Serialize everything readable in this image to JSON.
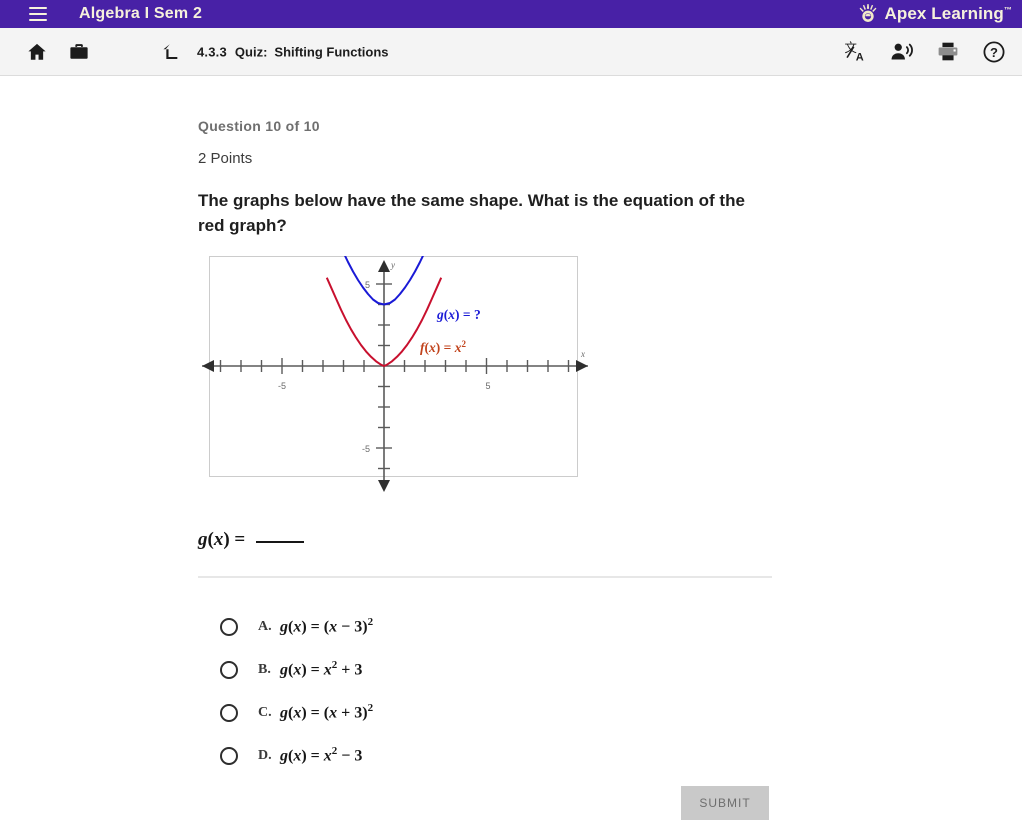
{
  "appbar": {
    "menu_icon": "hamburger-menu-icon",
    "course_title": "Algebra I Sem 2",
    "brand_name": "Apex Learning",
    "brand_tm": "™",
    "brand_logo": "apex-sunburst-logo",
    "background_color": "#4821a6",
    "text_color": "#f6f1dc"
  },
  "toolbar": {
    "home_icon": "home-icon",
    "briefcase_icon": "briefcase-icon",
    "up_level_icon": "up-level-arrow-icon",
    "breadcrumb": {
      "number": "4.3.3",
      "kind": "Quiz:",
      "name": "Shifting Functions"
    },
    "translate_icon": "translate-icon",
    "read_aloud_icon": "read-aloud-icon",
    "print_icon": "print-icon",
    "help_icon": "help-circle-icon",
    "background_color": "#f4f4f4"
  },
  "question": {
    "counter": "Question 10 of 10",
    "points": "2 Points",
    "prompt": "The graphs below have the same shape. What is the equation of the red graph?",
    "answer_prompt_g": "g",
    "answer_prompt_paren_open": "(",
    "answer_prompt_x": "x",
    "answer_prompt_paren_close": ")",
    "answer_prompt_equals": " = "
  },
  "chart_data": {
    "type": "line",
    "title": "",
    "xlabel": "x",
    "ylabel": "y",
    "xlim": [
      -9,
      9
    ],
    "ylim": [
      -7.5,
      7.5
    ],
    "grid": false,
    "tick_step": 1,
    "xticks_labeled": [
      -5,
      5
    ],
    "yticks_labeled": [
      -5,
      5
    ],
    "xtick_labels": [
      "-5",
      "5"
    ],
    "ytick_labels": [
      "-5",
      "5"
    ],
    "series": [
      {
        "name": "f(x) = x2",
        "label": "f(x) = x",
        "label_exponent": "2",
        "color": "#c8102e",
        "vertex": [
          0,
          0
        ],
        "equation": "y = x^2",
        "points": [
          [
            -2.7,
            7.3
          ],
          [
            -2.2,
            4.84
          ],
          [
            -1.7,
            2.89
          ],
          [
            -1.2,
            1.44
          ],
          [
            -0.7,
            0.49
          ],
          [
            0,
            0
          ],
          [
            0.7,
            0.49
          ],
          [
            1.2,
            1.44
          ],
          [
            1.7,
            2.89
          ],
          [
            2.2,
            4.84
          ],
          [
            2.7,
            7.3
          ]
        ]
      },
      {
        "name": "g(x) = ?",
        "label": "g(x) = ?",
        "color": "#1a1ad6",
        "vertex": [
          0,
          3
        ],
        "equation": "y = x^2 + 3",
        "points": [
          [
            -2.1,
            7.41
          ],
          [
            -1.7,
            5.89
          ],
          [
            -1.2,
            4.44
          ],
          [
            -0.7,
            3.49
          ],
          [
            0,
            3
          ],
          [
            0.7,
            3.49
          ],
          [
            1.2,
            4.44
          ],
          [
            1.7,
            5.89
          ],
          [
            2.1,
            7.41
          ]
        ]
      }
    ],
    "annotations": [
      {
        "text": "g(x) = ?",
        "x": 2.6,
        "y": 5.0,
        "color": "#1a1ad6"
      },
      {
        "text": "f(x) = x",
        "sup": "2",
        "x": 1.9,
        "y": 1.6,
        "color": "#c1431c"
      }
    ]
  },
  "choices": [
    {
      "letter": "A.",
      "g": "g",
      "x1": "x",
      "eq": " = (",
      "x2": "x",
      "op": " − 3)",
      "sup": "2",
      "tail": ""
    },
    {
      "letter": "B.",
      "g": "g",
      "x1": "x",
      "eq": " = ",
      "x2": "x",
      "op": "",
      "sup": "2",
      "tail": " + 3"
    },
    {
      "letter": "C.",
      "g": "g",
      "x1": "x",
      "eq": " = (",
      "x2": "x",
      "op": " + 3)",
      "sup": "2",
      "tail": ""
    },
    {
      "letter": "D.",
      "g": "g",
      "x1": "x",
      "eq": " = ",
      "x2": "x",
      "op": "",
      "sup": "2",
      "tail": " − 3"
    }
  ],
  "submit": {
    "label": "SUBMIT",
    "enabled": false,
    "background_color": "#c9c9c9",
    "text_color": "#6e6e6e"
  }
}
